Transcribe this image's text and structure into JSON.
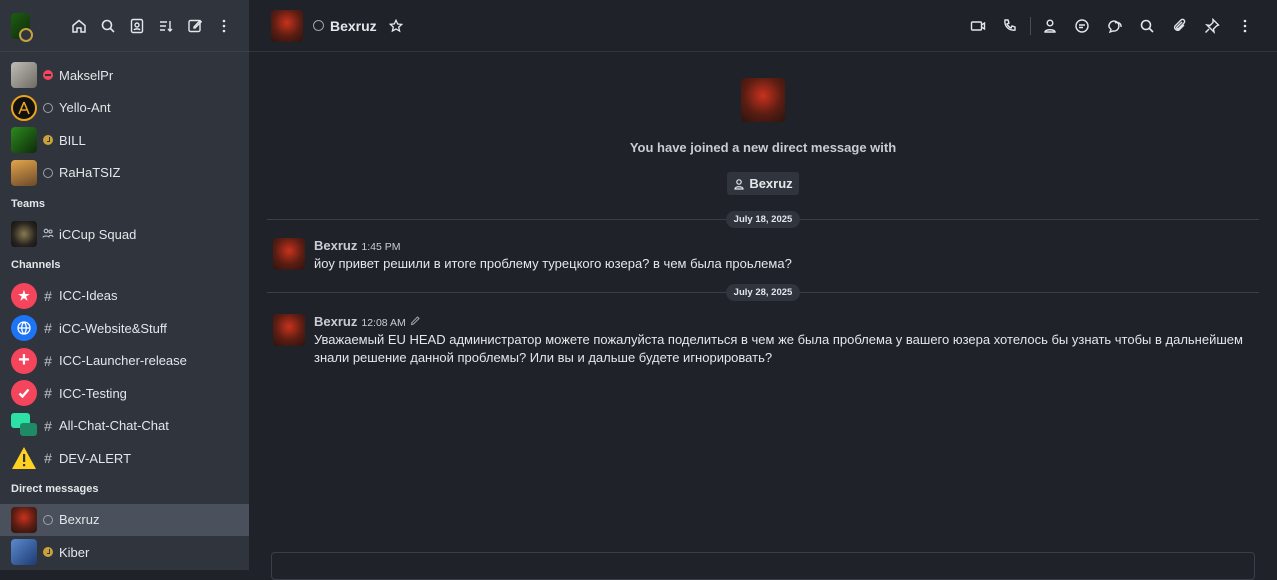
{
  "sidebar": {
    "tools": [
      {
        "icon": "home-icon"
      },
      {
        "icon": "search-icon"
      },
      {
        "icon": "directory-icon"
      },
      {
        "icon": "sort-icon"
      },
      {
        "icon": "create-new-icon"
      },
      {
        "icon": "kebab-menu-icon"
      }
    ],
    "direct_top": [
      {
        "name": "MakselPr",
        "status": "busy"
      },
      {
        "name": "Yello-Ant",
        "status": "offline"
      },
      {
        "name": "BILL",
        "status": "away"
      },
      {
        "name": "RaHaTSIZ",
        "status": "offline"
      }
    ],
    "teams_label": "Teams",
    "teams": [
      {
        "name": "iCCup Squad"
      }
    ],
    "channels_label": "Channels",
    "channels": [
      {
        "name": "ICC-Ideas",
        "color": "#f5455c"
      },
      {
        "name": "iCC-Website&Stuff",
        "color": "#1d74f5"
      },
      {
        "name": "ICC-Launcher-release",
        "color": "#f5455c"
      },
      {
        "name": "ICC-Testing",
        "color": "#f5455c"
      },
      {
        "name": "All-Chat-Chat-Chat",
        "color": "#2de0a5"
      },
      {
        "name": "DEV-ALERT",
        "color": "#ffd21f"
      }
    ],
    "dm_label": "Direct messages",
    "dms": [
      {
        "name": "Bexruz",
        "status": "offline"
      },
      {
        "name": "Kiber",
        "status": "away"
      }
    ]
  },
  "header": {
    "name": "Bexruz"
  },
  "intro": {
    "text": "You have joined a new direct message with",
    "user": "Bexruz"
  },
  "messages": [
    {
      "date": "July 18, 2025",
      "user": "Bexruz",
      "time": "1:45 PM",
      "text": "йоу привет решили в итоге проблему турецкого юзера? в чем была проьлема?"
    },
    {
      "date": "July 28, 2025",
      "user": "Bexruz",
      "time": "12:08 AM",
      "text": "Уважаемый EU HEAD администратор можете пожалуйста поделиться в чем же была проблема у вашего юзера хотелось бы узнать чтобы в дальнейшем знали решение данной проблемы? Или вы и дальше будете игнорировать?"
    }
  ]
}
